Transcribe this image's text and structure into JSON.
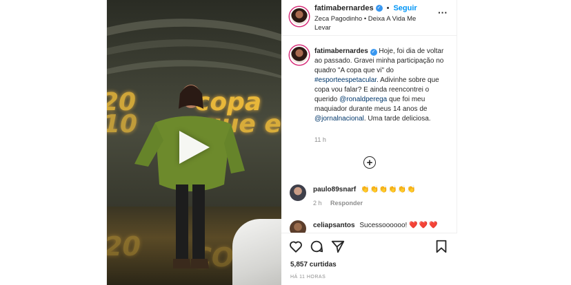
{
  "header": {
    "username": "fatimabernardes",
    "follow_label": "Seguir",
    "audio": "Zeca Pagodinho • Deixa A Vida Me Levar",
    "more_icon": "more-options-icon"
  },
  "media": {
    "led_text_1": "20",
    "led_text_2": "copa",
    "led_text_3": "10",
    "led_text_4": "que eu v",
    "led_text_5": "20",
    "led_text_6": "CO"
  },
  "caption": {
    "username": "fatimabernardes",
    "text_1": "Hoje, foi dia de voltar ao passado. Gravei minha participação no quadro \"A copa que vi\" do ",
    "hashtag": "#esporteespetacular",
    "text_2": ". Adivinhe sobre que copa vou falar? E ainda reencontrei o querido ",
    "mention_1": "@ronaldperega",
    "text_3": " que foi meu maquiador durante meus 14 anos de ",
    "mention_2": "@jornalnacional",
    "text_4": ". Uma tarde deliciosa.",
    "time": "11 h"
  },
  "load_more_label": "+",
  "comments": [
    {
      "username": "paulo89snarf",
      "text": "👏👏👏👏👏👏",
      "time": "2 h",
      "reply_label": "Responder"
    },
    {
      "username": "celiapsantos",
      "text": "Sucessoooooo!",
      "emoji": "❤️❤️❤️"
    }
  ],
  "actions": {
    "likes": "5,857 curtidas",
    "posted": "HÁ 11 HORAS"
  },
  "colors": {
    "accent": "#0095f6",
    "verified": "#3897f0",
    "text": "#262626",
    "muted": "#8e8e8e",
    "link": "#00376b"
  }
}
